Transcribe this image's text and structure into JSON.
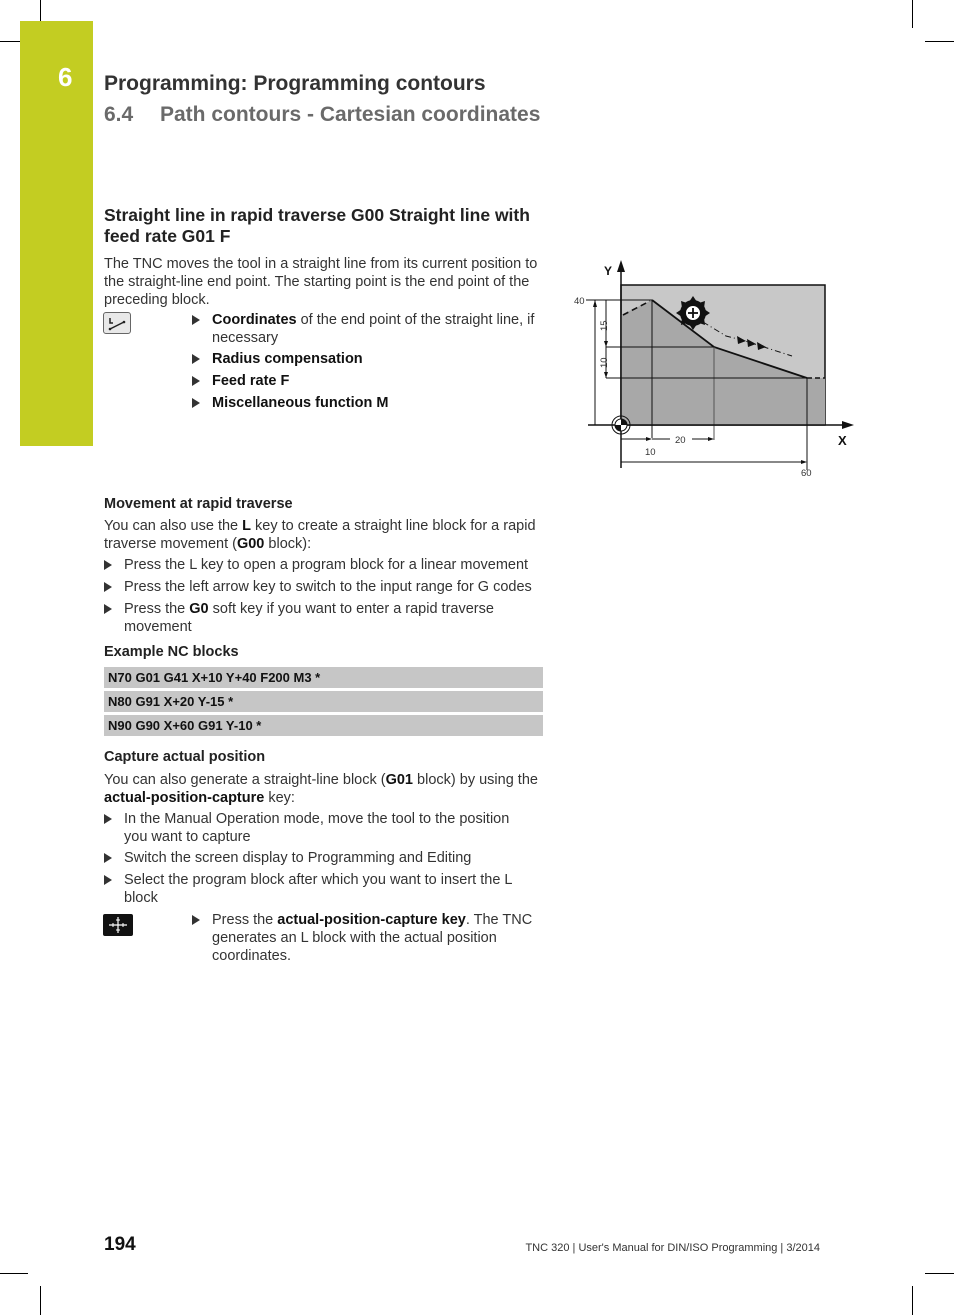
{
  "header": {
    "chapter_number": "6",
    "chapter_title": "Programming: Programming contours",
    "section_number": "6.4",
    "section_title": "Path contours - Cartesian coordinates"
  },
  "colors": {
    "chapter_tab": "#c3cd22",
    "nc_block_bg": "#c6c6c6",
    "workpiece_dark": "#a8a8a8",
    "workpiece_light": "#c8c8c8"
  },
  "section": {
    "title": "Straight line in rapid traverse G00 Straight line with feed rate G01 F",
    "intro": "The TNC moves the tool in a straight line from its current position to the straight-line end point. The starting point is the end point of the preceding block.",
    "key_icon": "straight-line-key-icon",
    "inputs": [
      {
        "bold": "Coordinates",
        "rest": " of the end point of the straight line, if necessary"
      },
      {
        "bold": "Radius compensation",
        "rest": ""
      },
      {
        "bold": "Feed rate F",
        "rest": ""
      },
      {
        "bold": "Miscellaneous function M",
        "rest": ""
      }
    ]
  },
  "diagram": {
    "axis_x": "X",
    "axis_y": "Y",
    "labels": {
      "y40": "40",
      "dim15": "15",
      "dim10": "10",
      "x10": "10",
      "x20": "20",
      "x60": "60"
    }
  },
  "rapid": {
    "heading": "Movement at rapid traverse",
    "para_1": "You can also use the ",
    "para_bold_1": "L",
    "para_2": " key to create a straight line block for a rapid traverse movement (",
    "para_bold_2": "G00",
    "para_3": " block):",
    "steps": [
      {
        "pre": "Press the L key to open a program block for a linear movement",
        "bold": "",
        "post": ""
      },
      {
        "pre": "Press the left arrow key to switch to the input range for G codes",
        "bold": "",
        "post": ""
      },
      {
        "pre": "Press the ",
        "bold": "G0",
        "post": " soft key if you want to enter a rapid traverse movement"
      }
    ]
  },
  "example": {
    "heading": "Example NC blocks",
    "blocks": [
      "N70 G01 G41 X+10 Y+40 F200 M3 *",
      "N80 G91 X+20 Y-15 *",
      "N90 G90 X+60 G91 Y-10 *"
    ]
  },
  "capture": {
    "heading": "Capture actual position",
    "para_1": "You can also generate a straight-line block (",
    "para_bold_1": "G01",
    "para_2": " block) by using the ",
    "para_bold_2": "actual-position-capture",
    "para_3": " key:",
    "steps": [
      "In the Manual Operation mode, move the tool to the position you want to capture",
      "Switch the screen display to Programming and Editing",
      "Select the program block after which you want to insert the L block"
    ],
    "key_icon": "actual-position-capture-key-icon",
    "final_pre": "Press the ",
    "final_bold": "actual-position-capture key",
    "final_post": ". The TNC generates an L block with the actual position coordinates."
  },
  "footer": {
    "page_number": "194",
    "text": "TNC 320 | User's Manual for DIN/ISO Programming | 3/2014"
  }
}
